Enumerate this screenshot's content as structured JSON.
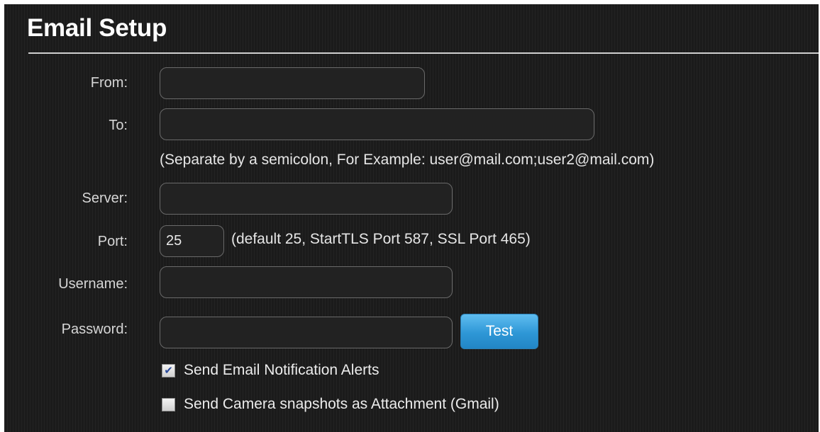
{
  "title": "Email Setup",
  "fields": {
    "from": {
      "label": "From:",
      "value": ""
    },
    "to": {
      "label": "To:",
      "value": ""
    },
    "to_hint": "(Separate by a semicolon, For Example: user@mail.com;user2@mail.com)",
    "server": {
      "label": "Server:",
      "value": ""
    },
    "port": {
      "label": "Port:",
      "value": "25",
      "hint": "(default 25, StartTLS Port 587, SSL Port 465)"
    },
    "username": {
      "label": "Username:",
      "value": ""
    },
    "password": {
      "label": "Password:",
      "value": ""
    }
  },
  "test_button": "Test",
  "checkboxes": [
    {
      "label": "Send Email Notification Alerts",
      "checked": true
    },
    {
      "label": "Send Camera snapshots as Attachment (Gmail)",
      "checked": false
    }
  ],
  "colors": {
    "accent": "#2e97d6",
    "background": "#1b1b1b"
  }
}
